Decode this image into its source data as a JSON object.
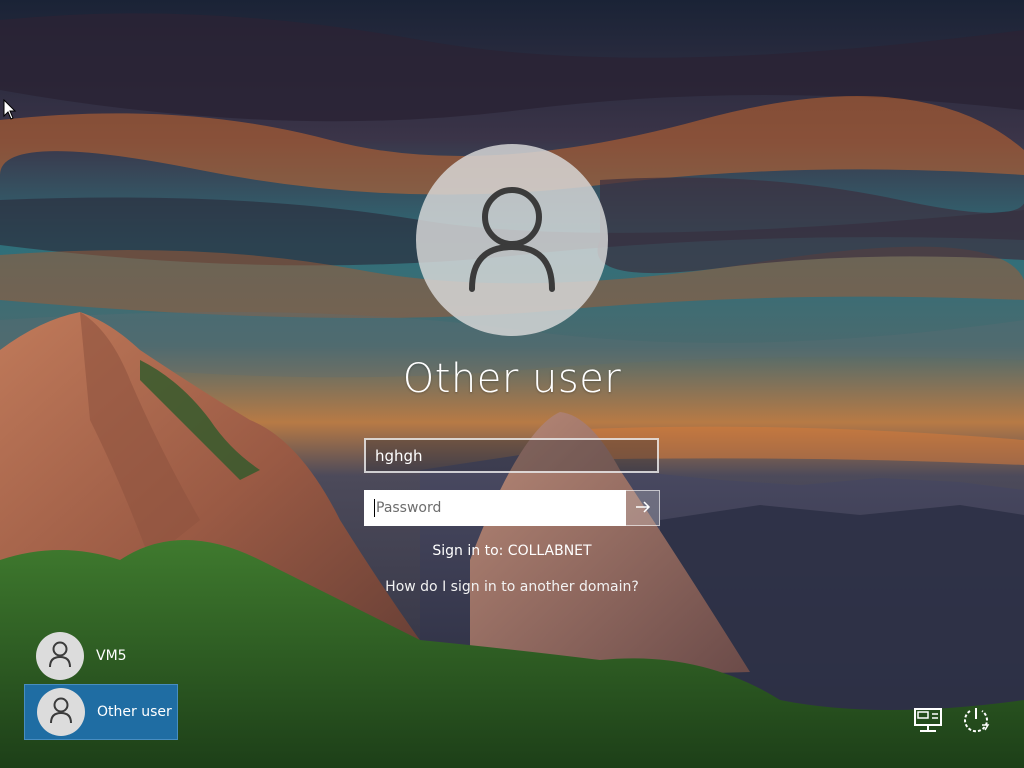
{
  "login": {
    "user_title": "Other user",
    "username_value": "hghgh",
    "password_placeholder": "Password",
    "sign_in_to": "Sign in to: COLLABNET",
    "other_domain_link": "How do I sign in to another domain?"
  },
  "user_list": [
    {
      "label": "VM5",
      "selected": false
    },
    {
      "label": "Other user",
      "selected": true
    }
  ],
  "icons": {
    "avatar": "user-silhouette-icon",
    "submit": "arrow-right-icon",
    "network": "network-icon",
    "power": "power-icon"
  },
  "colors": {
    "selected_tile": "#1f6da3",
    "avatar_bg": "#dadada",
    "avatar_glyph": "#3b3b3b"
  }
}
